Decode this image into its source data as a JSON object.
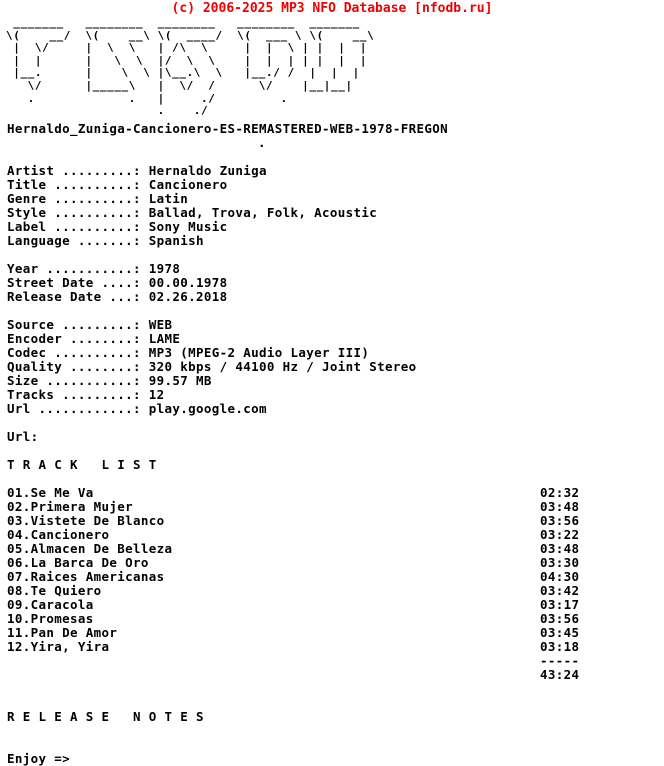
{
  "header": {
    "credit": "(c) 2006-2025 MP3 NFO Database [nfodb.ru]",
    "credit_color": "#ee0000"
  },
  "logo": {
    "alt": "fregon-ascii-logo",
    "lines": [
      " _______   ________  ________   ________  _______",
      "\\(    __/  \\(    __\\ \\(  ____/  \\(  ___ \\ \\(    __\\",
      " |  \\/     |  \\  \\   | /\\  \\     |  |  \\ | |  |  |",
      " |  |      |   \\  \\  |/  \\  \\    |  |  | | |  |  |",
      " |__.      |    \\  \\ |\\__.\\  \\   |__./ /  |  |  |",
      "   \\/      |_____\\   |  \\/  /      \\/    |__|__|",
      "   .             .   |     ./         .",
      "                     .    ./"
    ]
  },
  "release": {
    "name": "Hernaldo_Zuniga-Cancionero-ES-REMASTERED-WEB-1978-FREGON",
    "separator_dot": "."
  },
  "info_block_1": [
    {
      "label": "Artist",
      "dots": ".........",
      "value": "Hernaldo Zuniga"
    },
    {
      "label": "Title",
      "dots": "..........",
      "value": "Cancionero"
    },
    {
      "label": "Genre",
      "dots": "..........",
      "value": "Latin"
    },
    {
      "label": "Style",
      "dots": "..........",
      "value": "Ballad, Trova, Folk, Acoustic"
    },
    {
      "label": "Label",
      "dots": "..........",
      "value": "Sony Music"
    },
    {
      "label": "Language",
      "dots": ".......",
      "value": "Spanish"
    }
  ],
  "info_block_2": [
    {
      "label": "Year",
      "dots": "...........",
      "value": "1978"
    },
    {
      "label": "Street Date",
      "dots": "....",
      "value": "00.00.1978"
    },
    {
      "label": "Release Date",
      "dots": "...",
      "value": "02.26.2018"
    }
  ],
  "info_block_3": [
    {
      "label": "Source",
      "dots": ".........",
      "value": "WEB"
    },
    {
      "label": "Encoder",
      "dots": "........",
      "value": "LAME"
    },
    {
      "label": "Codec",
      "dots": "..........",
      "value": "MP3 (MPEG-2 Audio Layer III)"
    },
    {
      "label": "Quality",
      "dots": "........",
      "value": "320 kbps / 44100 Hz / Joint Stereo"
    },
    {
      "label": "Size",
      "dots": "...........",
      "value": "99.57 MB"
    },
    {
      "label": "Tracks",
      "dots": ".........",
      "value": "12"
    },
    {
      "label": "Url",
      "dots": "............",
      "value": "play.google.com"
    }
  ],
  "url_bare": {
    "label": "Url:"
  },
  "tracklist": {
    "title": "T R A C K   L I S T",
    "tracks": [
      {
        "num": "01.",
        "title": "Se Me Va",
        "duration": "02:32"
      },
      {
        "num": "02.",
        "title": "Primera Mujer",
        "duration": "03:48"
      },
      {
        "num": "03.",
        "title": "Vistete De Blanco",
        "duration": "03:56"
      },
      {
        "num": "04.",
        "title": "Cancionero",
        "duration": "03:22"
      },
      {
        "num": "05.",
        "title": "Almacen De Belleza",
        "duration": "03:48"
      },
      {
        "num": "06.",
        "title": "La Barca De Oro",
        "duration": "03:30"
      },
      {
        "num": "07.",
        "title": "Raices Americanas",
        "duration": "04:30"
      },
      {
        "num": "08.",
        "title": "Te Quiero",
        "duration": "03:42"
      },
      {
        "num": "09.",
        "title": "Caracola",
        "duration": "03:17"
      },
      {
        "num": "10.",
        "title": "Promesas",
        "duration": "03:56"
      },
      {
        "num": "11.",
        "title": "Pan De Amor",
        "duration": "03:45"
      },
      {
        "num": "12.",
        "title": "Yira, Yira",
        "duration": "03:18"
      }
    ],
    "separator": "-----",
    "total_duration": "43:24"
  },
  "notes": {
    "title": "R E L E A S E   N O T E S",
    "body": "Enjoy =>"
  }
}
